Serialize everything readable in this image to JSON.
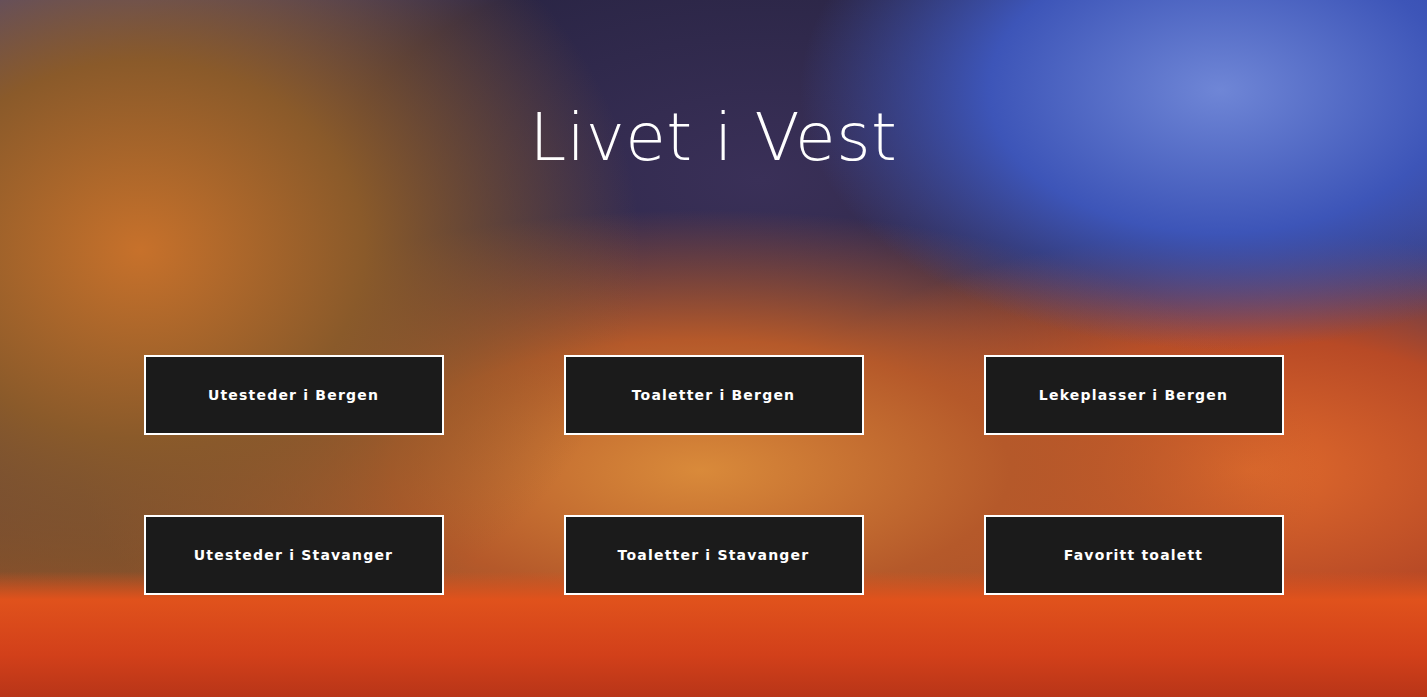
{
  "page": {
    "title": "Livet i Vest"
  },
  "buttons": [
    {
      "label": "Utesteder i Bergen"
    },
    {
      "label": "Toaletter i Bergen"
    },
    {
      "label": "Lekeplasser i Bergen"
    },
    {
      "label": "Utesteder i Stavanger"
    },
    {
      "label": "Toaletter i Stavanger"
    },
    {
      "label": "Favoritt toalett"
    }
  ]
}
